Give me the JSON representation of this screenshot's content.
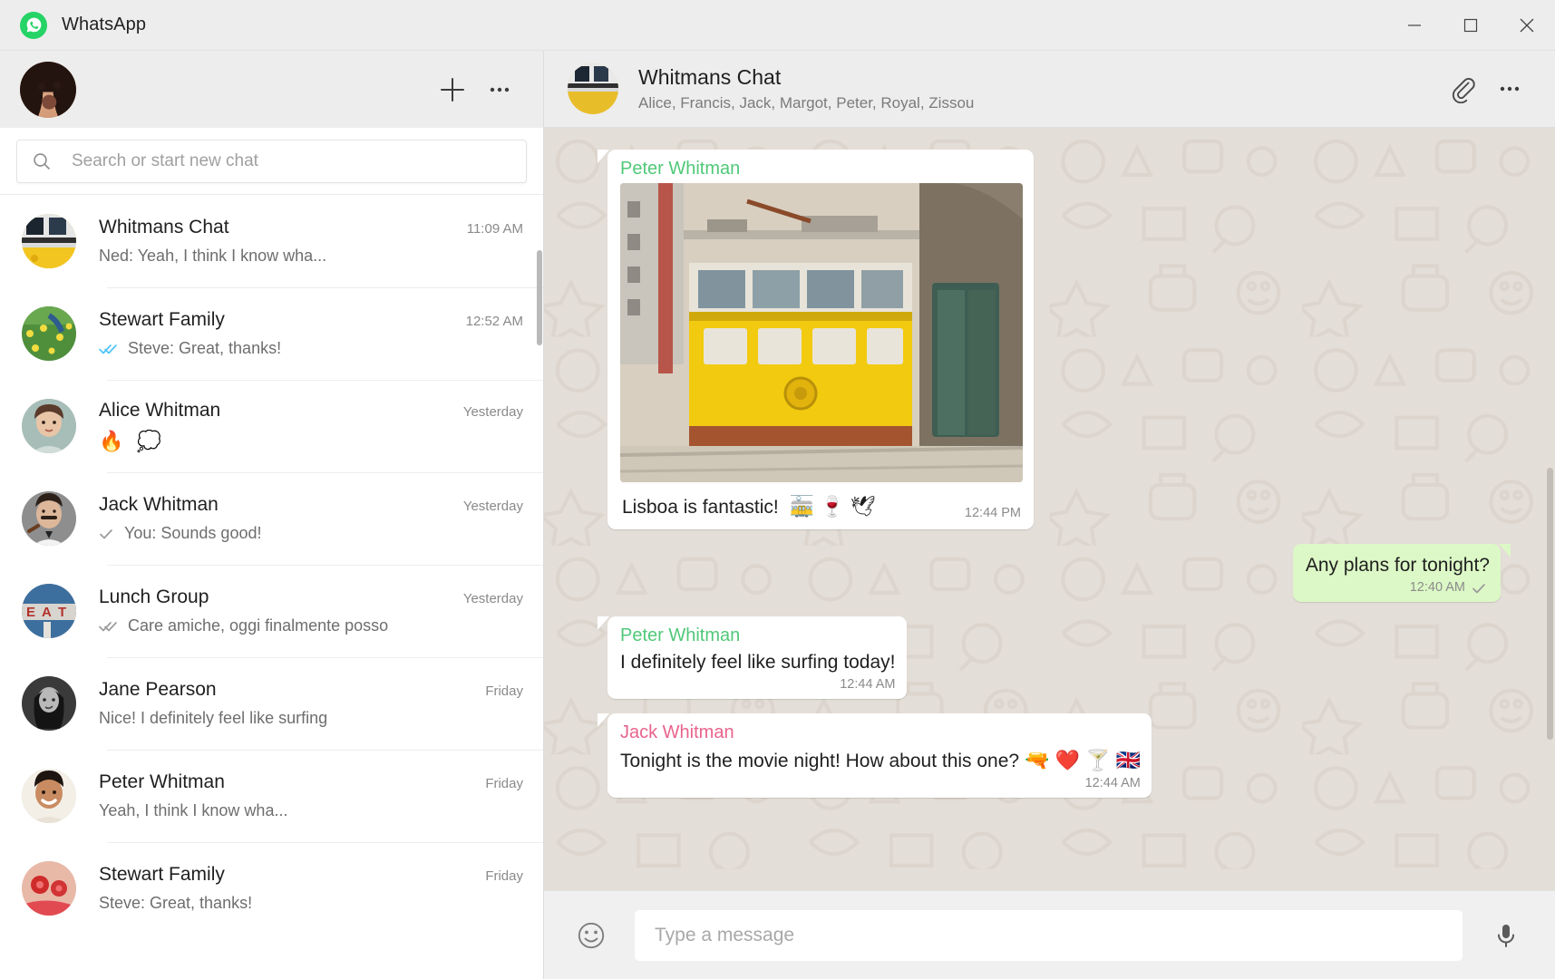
{
  "window": {
    "app_title": "WhatsApp",
    "minimize_label": "Minimize",
    "maximize_label": "Maximize",
    "close_label": "Close"
  },
  "sidebar": {
    "new_chat_label": "New chat",
    "menu_label": "Menu",
    "profile_label": "Profile photo",
    "search": {
      "placeholder": "Search or start new chat",
      "value": ""
    },
    "chats": [
      {
        "name": "Whitmans Chat",
        "time": "11:09 AM",
        "snippet": "Ned: Yeah, I think I know wha...",
        "ticks": "none",
        "selected": true,
        "avatar": "tram"
      },
      {
        "name": "Stewart Family",
        "time": "12:52 AM",
        "snippet": "Steve: Great, thanks!",
        "ticks": "read",
        "selected": false,
        "avatar": "flowers"
      },
      {
        "name": "Alice Whitman",
        "time": "Yesterday",
        "snippet": "🔥 💭",
        "ticks": "none",
        "selected": false,
        "avatar": "alice",
        "emoji_only": true
      },
      {
        "name": "Jack Whitman",
        "time": "Yesterday",
        "snippet": "You: Sounds good!",
        "ticks": "sent",
        "selected": false,
        "avatar": "jack"
      },
      {
        "name": "Lunch Group",
        "time": "Yesterday",
        "snippet": "Care amiche, oggi finalmente posso",
        "ticks": "delivered",
        "selected": false,
        "avatar": "eat"
      },
      {
        "name": "Jane Pearson",
        "time": "Friday",
        "snippet": "Nice! I definitely feel like surfing",
        "ticks": "none",
        "selected": false,
        "avatar": "jane"
      },
      {
        "name": "Peter Whitman",
        "time": "Friday",
        "snippet": "Yeah, I think I know wha...",
        "ticks": "none",
        "selected": false,
        "avatar": "peter"
      },
      {
        "name": "Stewart Family",
        "time": "Friday",
        "snippet": "Steve: Great, thanks!",
        "ticks": "none",
        "selected": false,
        "avatar": "berries"
      }
    ]
  },
  "conversation": {
    "title": "Whitmans Chat",
    "participants": "Alice, Francis, Jack, Margot, Peter, Royal, Zissou",
    "attach_label": "Attach",
    "menu_label": "Menu",
    "messages": [
      {
        "id": "m1",
        "direction": "in",
        "sender": "Peter Whitman",
        "sender_color": "#50c878",
        "type": "image",
        "image_alt": "Yellow tram on a Lisbon street",
        "caption": "Lisboa is fantastic!",
        "caption_emoji": "🚋 🍷 🕊",
        "time": "12:44 PM",
        "ticks": "none"
      },
      {
        "id": "m2",
        "direction": "out",
        "sender": "",
        "type": "text",
        "text": "Any plans for tonight?",
        "time": "12:40 AM",
        "ticks": "sent"
      },
      {
        "id": "m3",
        "direction": "in",
        "sender": "Peter Whitman",
        "sender_color": "#50c878",
        "type": "text",
        "text": "I definitely feel like surfing today!",
        "time": "12:44 AM",
        "ticks": "none"
      },
      {
        "id": "m4",
        "direction": "in",
        "sender": "Jack Whitman",
        "sender_color": "#e8638c",
        "type": "text",
        "text": "Tonight is the movie night! How about this one? ",
        "text_emoji": "🔫 ❤️ 🍸 🇬🇧",
        "time": "12:44 AM",
        "ticks": "none"
      }
    ]
  },
  "composer": {
    "emoji_label": "Emoji",
    "mic_label": "Voice message",
    "placeholder": "Type a message",
    "value": ""
  },
  "colors": {
    "brand_green": "#25D366",
    "outgoing_bubble": "#dcf8c6",
    "incoming_bubble": "#ffffff",
    "chat_background": "#e4ded8",
    "panel_grey": "#ededed",
    "tick_blue": "#4fc3f7",
    "tick_grey": "#9a9a9a"
  }
}
